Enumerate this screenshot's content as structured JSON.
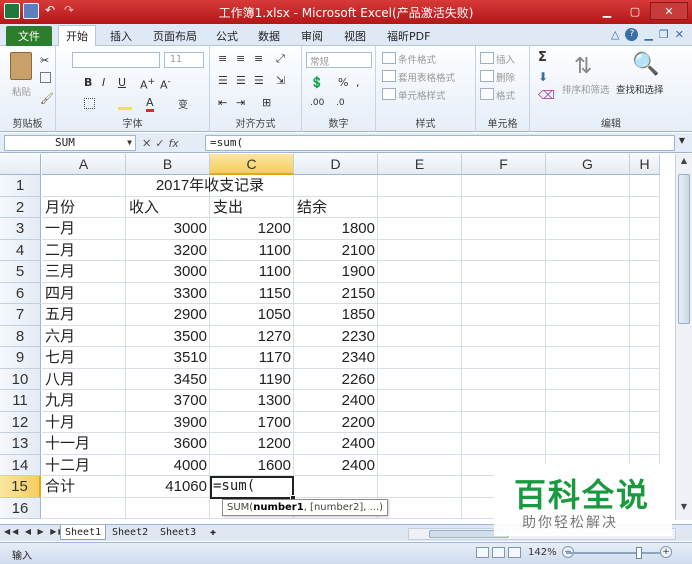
{
  "window": {
    "title": "工作簿1.xlsx - Microsoft Excel(产品激活失败)",
    "minimize": "▁",
    "maximize": "▢",
    "close": "✕"
  },
  "ribbon_tabs": {
    "file": "文件",
    "tabs": [
      "开始",
      "插入",
      "页面布局",
      "公式",
      "数据",
      "审阅",
      "视图",
      "福昕PDF"
    ],
    "active": "开始"
  },
  "ribbon": {
    "clipboard": {
      "label": "剪贴板",
      "paste": "粘贴"
    },
    "font": {
      "label": "字体",
      "size": "11"
    },
    "alignment": {
      "label": "对齐方式"
    },
    "number": {
      "label": "数字",
      "format": "常规"
    },
    "styles": {
      "label": "样式",
      "conditional": "条件格式",
      "table": "套用表格格式",
      "cell": "单元格样式"
    },
    "cells": {
      "label": "单元格",
      "insert": "插入",
      "delete": "删除",
      "format": "格式"
    },
    "editing": {
      "label": "编辑",
      "sort": "排序和筛选",
      "find": "查找和选择"
    }
  },
  "formula_bar": {
    "name_box": "SUM",
    "cancel": "✕",
    "enter": "✓",
    "fx": "fx",
    "content": "=sum("
  },
  "grid": {
    "columns": [
      "A",
      "B",
      "C",
      "D",
      "E",
      "F",
      "G",
      "H"
    ],
    "rows": [
      "1",
      "2",
      "3",
      "4",
      "5",
      "6",
      "7",
      "8",
      "9",
      "10",
      "11",
      "12",
      "13",
      "14",
      "15",
      "16"
    ],
    "active_column": "C",
    "active_row": "15",
    "title": "2017年收支记录",
    "headers": {
      "month": "月份",
      "income": "收入",
      "expense": "支出",
      "balance": "结余"
    },
    "data": [
      [
        "一月",
        "3000",
        "1200",
        "1800"
      ],
      [
        "二月",
        "3200",
        "1100",
        "2100"
      ],
      [
        "三月",
        "3000",
        "1100",
        "1900"
      ],
      [
        "四月",
        "3300",
        "1150",
        "2150"
      ],
      [
        "五月",
        "2900",
        "1050",
        "1850"
      ],
      [
        "六月",
        "3500",
        "1270",
        "2230"
      ],
      [
        "七月",
        "3510",
        "1170",
        "2340"
      ],
      [
        "八月",
        "3450",
        "1190",
        "2260"
      ],
      [
        "九月",
        "3700",
        "1300",
        "2400"
      ],
      [
        "十月",
        "3900",
        "1700",
        "2200"
      ],
      [
        "十一月",
        "3600",
        "1200",
        "2400"
      ],
      [
        "十二月",
        "4000",
        "1600",
        "2400"
      ]
    ],
    "total_label": "合计",
    "total_income": "41060",
    "editing_text": "=sum("
  },
  "tooltip": {
    "prefix": "SUM(",
    "arg1": "number1",
    "rest": ", [number2], ...)"
  },
  "sheets": [
    "Sheet1",
    "Sheet2",
    "Sheet3"
  ],
  "active_sheet": "Sheet1",
  "status": {
    "mode": "输入",
    "zoom": "142%"
  },
  "watermark": {
    "main": "百科全说",
    "sub": "助你轻松解决"
  }
}
